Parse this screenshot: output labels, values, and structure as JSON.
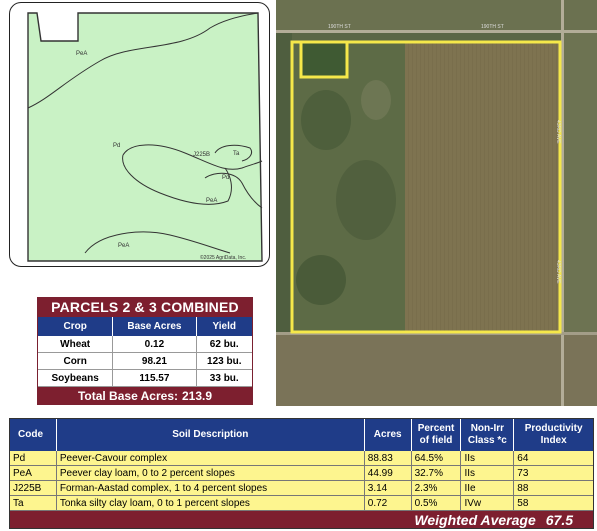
{
  "soil_map": {
    "labels": [
      "PeA",
      "Pd",
      "J225B",
      "Ta",
      "Pd",
      "PeA",
      "PeA"
    ],
    "copyright": "©2025 AgriData, Inc.",
    "fill_color": "#c9f2c5"
  },
  "aerial": {
    "road_labels": [
      "190TH ST",
      "190TH ST",
      "43RD AVE",
      "43RD AVE"
    ],
    "boundary_color": "#f5e84a"
  },
  "parcels": {
    "title": "PARCELS 2 & 3 COMBINED",
    "headers": [
      "Crop",
      "Base Acres",
      "Yield"
    ],
    "rows": [
      [
        "Wheat",
        "0.12",
        "62 bu."
      ],
      [
        "Corn",
        "98.21",
        "123 bu."
      ],
      [
        "Soybeans",
        "115.57",
        "33 bu."
      ]
    ],
    "total_label": "Total Base Acres:",
    "total_value": "213.9"
  },
  "soil_table": {
    "headers": [
      "Code",
      "Soil Description",
      "Acres",
      "Percent of field",
      "Non-Irr Class *c",
      "Productivity Index"
    ],
    "rows": [
      [
        "Pd",
        "Peever-Cavour complex",
        "88.83",
        "64.5%",
        "IIs",
        "64"
      ],
      [
        "PeA",
        "Peever clay loam, 0 to 2 percent slopes",
        "44.99",
        "32.7%",
        "IIs",
        "73"
      ],
      [
        "J225B",
        "Forman-Aastad complex, 1 to 4 percent slopes",
        "3.14",
        "2.3%",
        "IIe",
        "88"
      ],
      [
        "Ta",
        "Tonka silty clay loam, 0 to 1 percent slopes",
        "0.72",
        "0.5%",
        "IVw",
        "58"
      ]
    ],
    "weighted_label": "Weighted Average",
    "weighted_value": "67.5"
  }
}
